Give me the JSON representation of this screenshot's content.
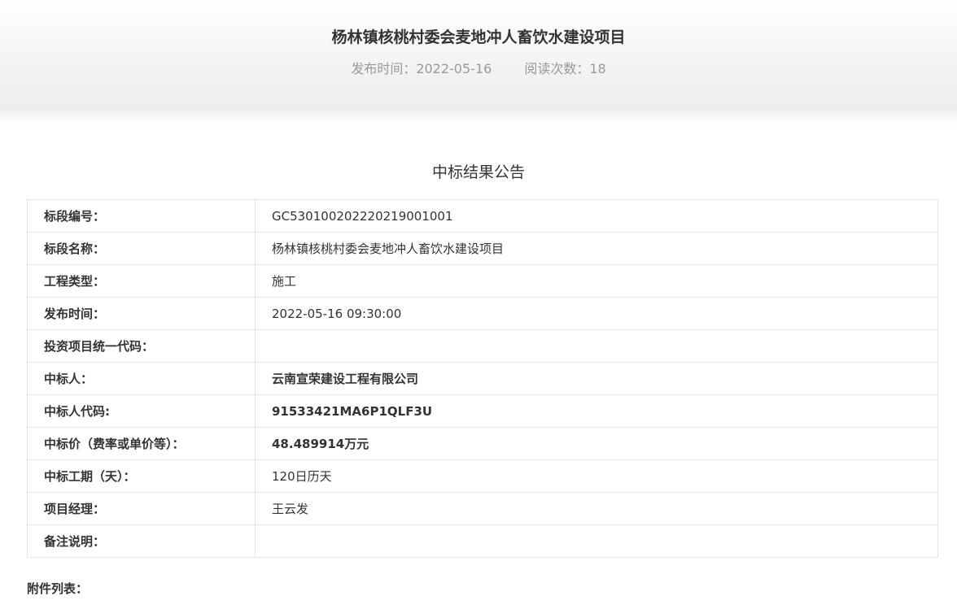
{
  "header": {
    "title": "杨林镇核桃村委会麦地冲人畜饮水建设项目",
    "publish_time": "发布时间：2022-05-16",
    "read_count": "阅读次数：18"
  },
  "notice": {
    "title": "中标结果公告"
  },
  "table": {
    "rows": [
      {
        "label": "标段编号：",
        "value": "GC530100202220219001001"
      },
      {
        "label": "标段名称：",
        "value": "杨林镇核桃村委会麦地冲人畜饮水建设项目"
      },
      {
        "label": "工程类型：",
        "value": "施工"
      },
      {
        "label": "发布时间：",
        "value": "2022-05-16 09:30:00"
      },
      {
        "label": "投资项目统一代码：",
        "value": ""
      },
      {
        "label": "中标人：",
        "value": "云南宣荣建设工程有限公司"
      },
      {
        "label": "中标人代码:",
        "value": "91533421MA6P1QLF3U"
      },
      {
        "label": "中标价（费率或单价等）：",
        "value": "48.489914万元"
      },
      {
        "label": "中标工期（天）：",
        "value": "120日历天"
      },
      {
        "label": "项目经理：",
        "value": "王云发"
      },
      {
        "label": "备注说明：",
        "value": ""
      }
    ]
  },
  "attachments": {
    "label": "附件列表："
  }
}
